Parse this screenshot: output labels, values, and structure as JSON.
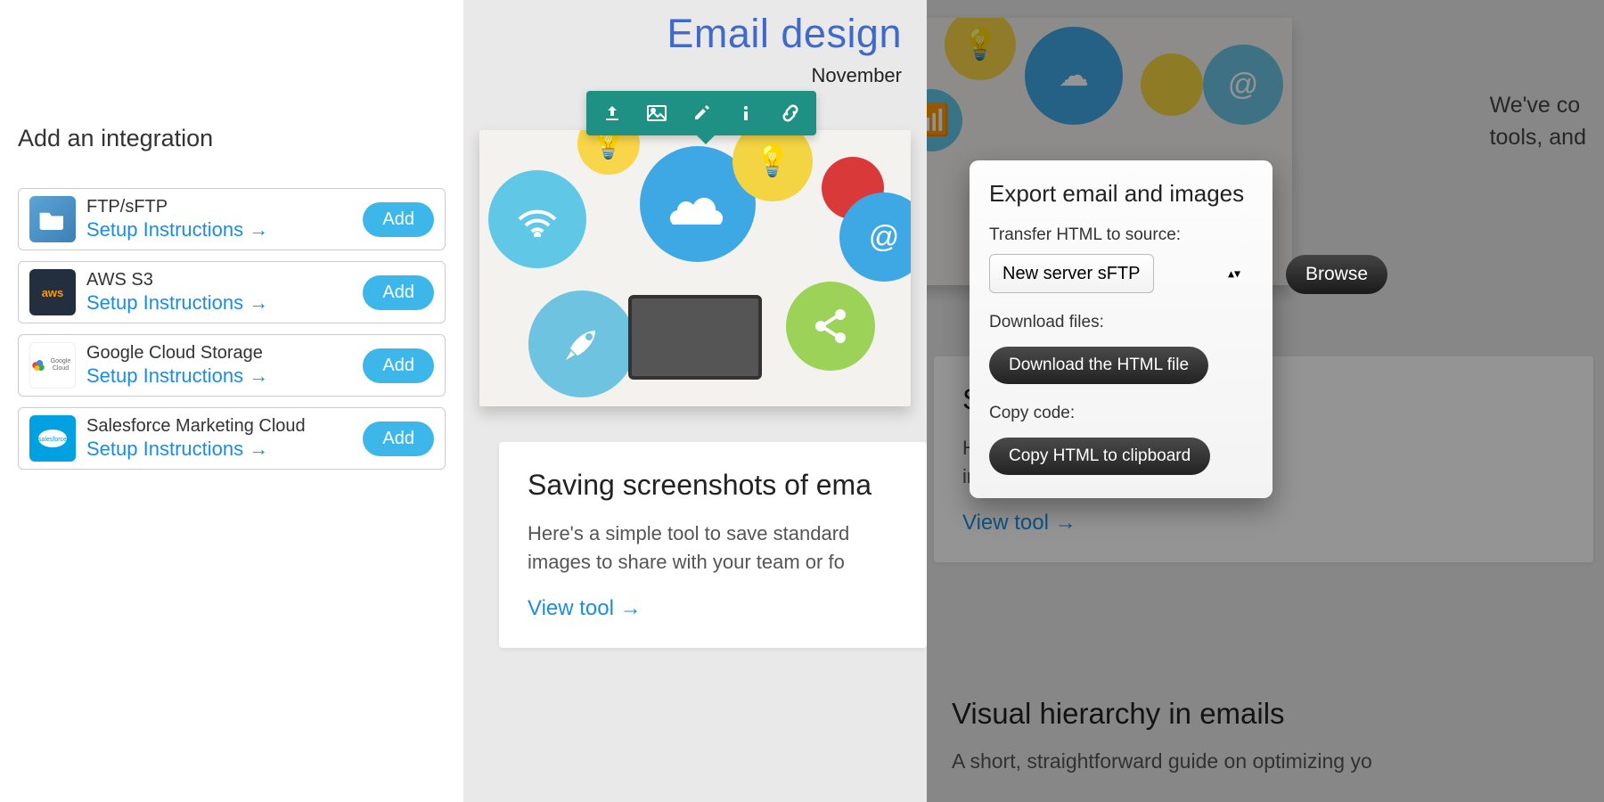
{
  "panel1": {
    "heading": "Add an integration",
    "items": [
      {
        "key": "ftp",
        "title": "FTP/sFTP",
        "link": "Setup Instructions",
        "add": "Add"
      },
      {
        "key": "aws",
        "title": "AWS S3",
        "link": "Setup Instructions",
        "add": "Add"
      },
      {
        "key": "gcs",
        "title": "Google Cloud Storage",
        "link": "Setup Instructions",
        "add": "Add"
      },
      {
        "key": "sfmc",
        "title": "Salesforce Marketing Cloud",
        "link": "Setup Instructions",
        "add": "Add"
      }
    ]
  },
  "panel2": {
    "title": "Email design",
    "date_partial": "November",
    "toolbar_icons": [
      "upload-icon",
      "image-icon",
      "edit-icon",
      "info-icon",
      "link-icon"
    ],
    "card_title": "Saving screenshots of ema",
    "card_body": "Here's a simple tool to save standard images to share with your team or fo",
    "view_tool": "View tool"
  },
  "panel3": {
    "bg_paragraph": "We've co\ntools, and",
    "bg_card_title": "S",
    "bg_card_body": "H\nin",
    "bg_card_link": "View tool",
    "bg_section2_title": "Visual hierarchy in emails",
    "bg_section2_body": "A short, straightforward guide on optimizing yo",
    "export": {
      "title": "Export email and images",
      "transfer_label": "Transfer HTML to source:",
      "select_value": "New server sFTP",
      "browse": "Browse",
      "download_label": "Download files:",
      "download_btn": "Download the HTML file",
      "copy_label": "Copy code:",
      "copy_btn": "Copy HTML to clipboard"
    }
  }
}
